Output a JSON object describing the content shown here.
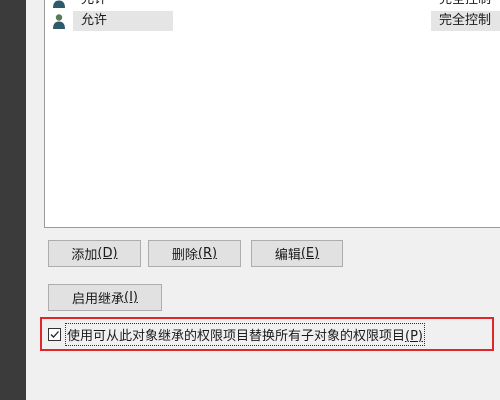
{
  "entries": [
    {
      "type": "允许",
      "access": "完全控制",
      "icon": "user-icon",
      "selected": false
    },
    {
      "type": "允许",
      "access": "完全控制",
      "icon": "user-icon",
      "selected": true
    }
  ],
  "buttons": {
    "add": {
      "label": "添加",
      "mnemonic": "(D)"
    },
    "remove": {
      "label": "删除",
      "mnemonic": "(R)"
    },
    "edit": {
      "label": "编辑",
      "mnemonic": "(E)"
    },
    "enable_inheritance": {
      "label": "启用继承",
      "mnemonic": "(I)"
    }
  },
  "replace_child_permissions": {
    "label": "使用可从此对象继承的权限项目替换所有子对象的权限项目",
    "mnemonic": "(P)",
    "checked": true
  },
  "colors": {
    "highlight_border": "#e0262c",
    "selection": "#e5e5e5",
    "rail": "#3b3b3b"
  }
}
